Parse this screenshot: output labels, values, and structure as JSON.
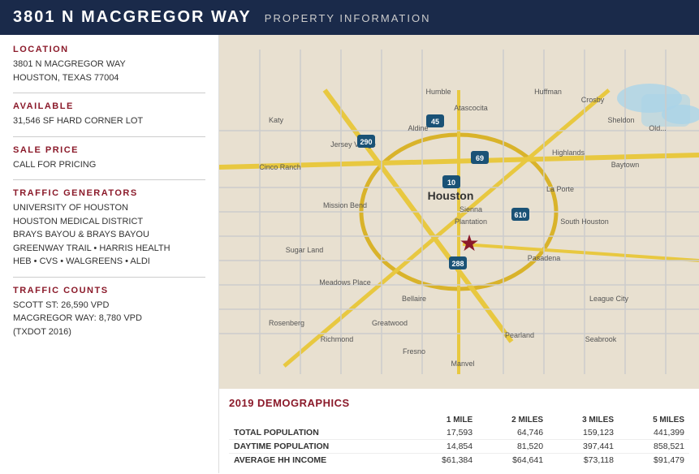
{
  "header": {
    "title": "3801 N MACGREGOR WAY",
    "subtitle": "PROPERTY INFORMATION"
  },
  "left": {
    "location_label": "LOCATION",
    "location_line1": "3801 N MACGREGOR WAY",
    "location_line2": "HOUSTON, TEXAS 77004",
    "available_label": "AVAILABLE",
    "available_value": "31,546 SF HARD CORNER LOT",
    "sale_price_label": "SALE PRICE",
    "sale_price_value": "CALL FOR PRICING",
    "traffic_gen_label": "TRAFFIC GENERATORS",
    "traffic_gen_1": "UNIVERSITY OF HOUSTON",
    "traffic_gen_2": "HOUSTON MEDICAL DISTRICT",
    "traffic_gen_3": "BRAYS BAYOU & BRAYS BAYOU",
    "traffic_gen_4": "GREENWAY TRAIL • HARRIS HEALTH",
    "traffic_gen_5": "HEB • CVS • WALGREENS • ALDI",
    "traffic_counts_label": "TRAFFIC COUNTS",
    "traffic_counts_1": "SCOTT ST: 26,590 VPD",
    "traffic_counts_2": "MACGREGOR WAY: 8,780 VPD",
    "traffic_counts_3": "(TXDOT 2016)"
  },
  "demographics": {
    "title": "2019 DEMOGRAPHICS",
    "columns": [
      "",
      "1 MILE",
      "2 MILES",
      "3 MILES",
      "5 MILES"
    ],
    "rows": [
      {
        "label": "TOTAL POPULATION",
        "v1": "17,593",
        "v2": "64,746",
        "v3": "159,123",
        "v4": "441,399"
      },
      {
        "label": "DAYTIME POPULATION",
        "v1": "14,854",
        "v2": "81,520",
        "v3": "397,441",
        "v4": "858,521"
      },
      {
        "label": "AVERAGE HH INCOME",
        "v1": "$61,384",
        "v2": "$64,641",
        "v3": "$73,118",
        "v4": "$91,479"
      }
    ]
  }
}
